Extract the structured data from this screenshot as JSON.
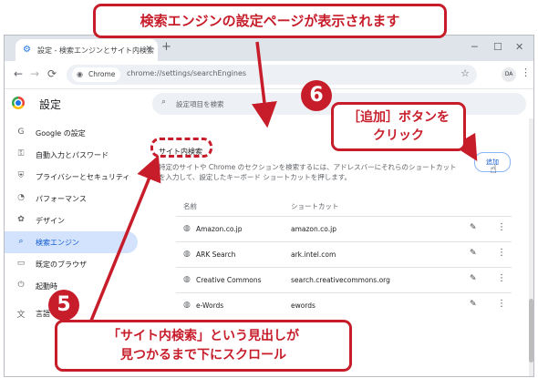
{
  "browser": {
    "tab_title": "設定 - 検索エンジンとサイト内検索",
    "new_tab": "+",
    "win_min": "─",
    "win_max": "☐",
    "win_close": "✕",
    "back": "←",
    "forward": "→",
    "reload": "⟳",
    "chip_label": "Chrome",
    "url": "chrome://settings/searchEngines",
    "avatar": "DA"
  },
  "settings": {
    "title": "設定",
    "search_placeholder": "設定項目を検索",
    "sidebar": [
      {
        "label": "Google の設定",
        "icon": "G",
        "name": "google"
      },
      {
        "label": "自動入力とパスワード",
        "icon": "⚿",
        "name": "autofill"
      },
      {
        "label": "プライバシーとセキュリティ",
        "icon": "⛨",
        "name": "privacy"
      },
      {
        "label": "パフォーマンス",
        "icon": "◔",
        "name": "performance"
      },
      {
        "label": "デザイン",
        "icon": "✿",
        "name": "design"
      },
      {
        "label": "検索エンジン",
        "icon": "⌕",
        "name": "search-engine"
      },
      {
        "label": "既定のブラウザ",
        "icon": "▭",
        "name": "default-browser"
      },
      {
        "label": "起動時",
        "icon": "⏻",
        "name": "startup"
      },
      {
        "label": "言語",
        "icon": "文",
        "name": "language"
      }
    ],
    "section_title": "サイト内検索",
    "description": "特定のサイトや Chrome のセクションを検索するには、アドレスバーにそれらのショートカットを入力して、設定したキーボード ショートカットを押します。",
    "add_button": "追加",
    "col_name": "名前",
    "col_shortcut": "ショートカット",
    "rows": [
      {
        "name": "Amazon.co.jp",
        "shortcut": "amazon.co.jp"
      },
      {
        "name": "ARK Search",
        "shortcut": "ark.intel.com"
      },
      {
        "name": "Creative Commons",
        "shortcut": "search.creativecommons.org"
      },
      {
        "name": "e-Words",
        "shortcut": "ewords"
      }
    ]
  },
  "annotations": {
    "top_callout": "検索エンジンの設定ページが表示されます",
    "step6_number": "6",
    "step6_line1": "［追加］ボタンを",
    "step6_line2": "クリック",
    "step5_number": "5",
    "step5_line1": "「サイト内検索」という見出しが",
    "step5_line2": "見つかるまで下にスクロール",
    "accent_color": "#c71d2a"
  }
}
